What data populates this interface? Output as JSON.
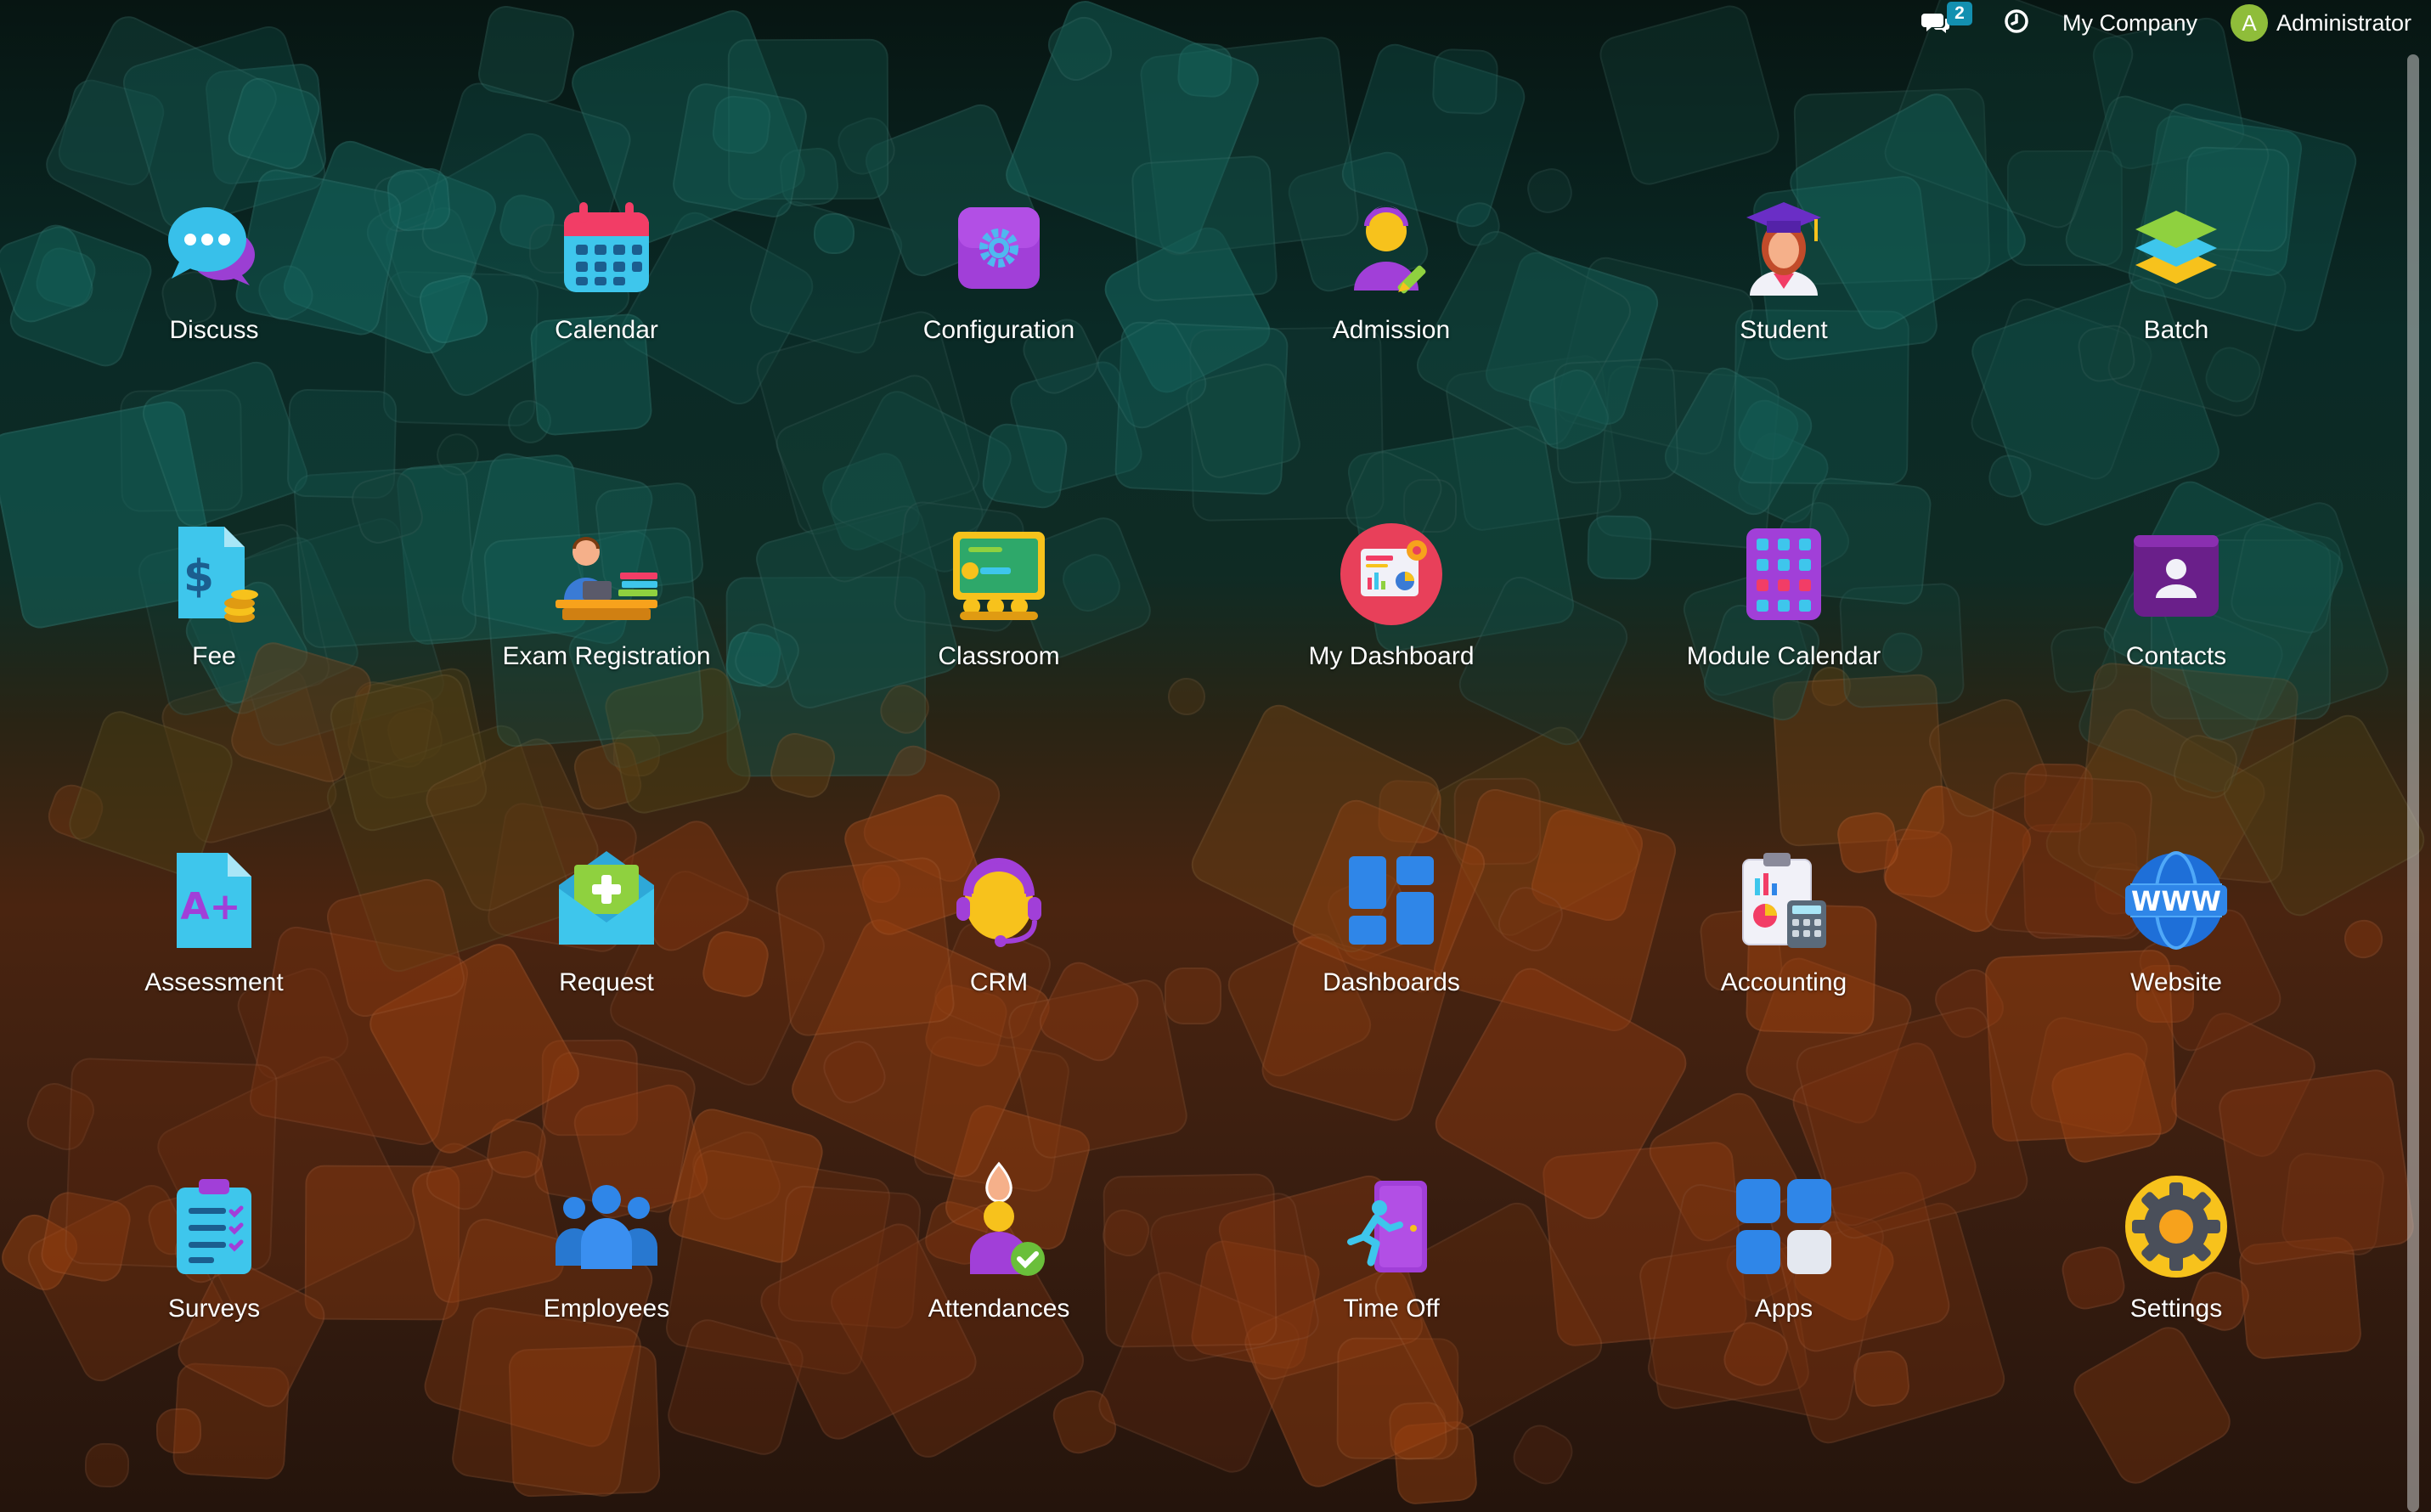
{
  "topbar": {
    "chat_icon": "chat-bubbles-icon",
    "chat_badge": "2",
    "activity_icon": "clock-icon",
    "company": "My Company",
    "avatar_letter": "A",
    "user_name": "Administrator"
  },
  "apps": [
    {
      "label": "Discuss",
      "icon": "chat-bubbles-icon"
    },
    {
      "label": "Calendar",
      "icon": "calendar-icon"
    },
    {
      "label": "Configuration",
      "icon": "gear-icon"
    },
    {
      "label": "Admission",
      "icon": "user-pencil-icon"
    },
    {
      "label": "Student",
      "icon": "graduate-icon"
    },
    {
      "label": "Batch",
      "icon": "layers-icon"
    },
    {
      "label": "Fee",
      "icon": "dollar-document-icon"
    },
    {
      "label": "Exam Registration",
      "icon": "desk-person-icon"
    },
    {
      "label": "Classroom",
      "icon": "blackboard-icon"
    },
    {
      "label": "My Dashboard",
      "icon": "dashboard-report-icon"
    },
    {
      "label": "Module Calendar",
      "icon": "module-grid-icon"
    },
    {
      "label": "Contacts",
      "icon": "contact-card-icon"
    },
    {
      "label": "Assessment",
      "icon": "grade-document-icon"
    },
    {
      "label": "Request",
      "icon": "envelope-plus-icon"
    },
    {
      "label": "CRM",
      "icon": "headset-agent-icon"
    },
    {
      "label": "Dashboards",
      "icon": "tiles-icon"
    },
    {
      "label": "Accounting",
      "icon": "clipboard-calculator-icon"
    },
    {
      "label": "Website",
      "icon": "www-globe-icon"
    },
    {
      "label": "Surveys",
      "icon": "checklist-icon"
    },
    {
      "label": "Employees",
      "icon": "people-group-icon"
    },
    {
      "label": "Attendances",
      "icon": "person-check-icon"
    },
    {
      "label": "Time Off",
      "icon": "running-door-icon"
    },
    {
      "label": "Apps",
      "icon": "app-squares-icon"
    },
    {
      "label": "Settings",
      "icon": "settings-gear-icon"
    }
  ],
  "colors": {
    "badge": "#1390b0",
    "avatar": "#8fbd3a"
  }
}
